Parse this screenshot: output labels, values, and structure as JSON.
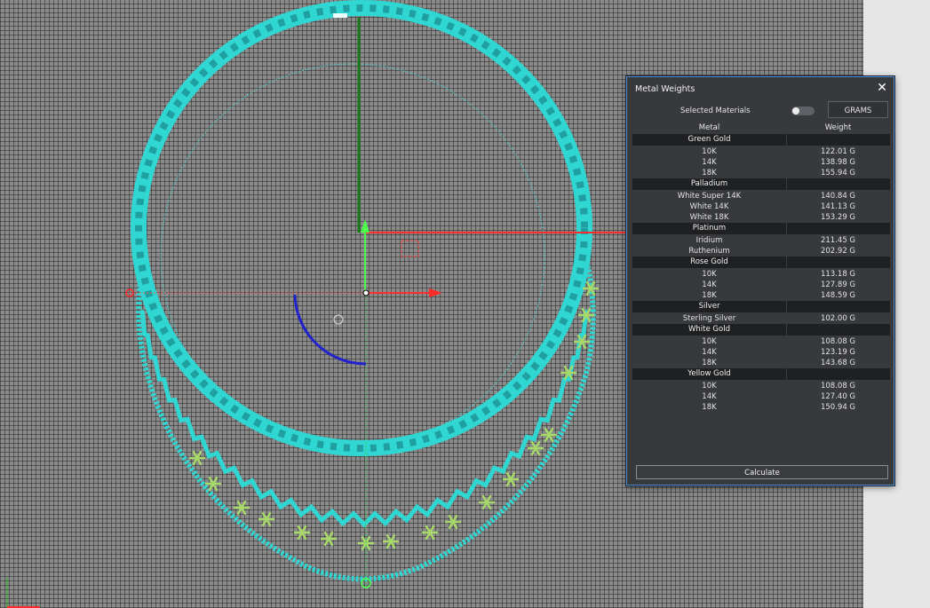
{
  "panel": {
    "title": "Metal Weights",
    "selected_label": "Selected Materials",
    "selected_on": false,
    "units_label": "GRAMS",
    "col_metal": "Metal",
    "col_weight": "Weight",
    "calculate_label": "Calculate",
    "groups": [
      {
        "name": "Green Gold",
        "items": [
          {
            "name": "10K",
            "weight": "122.01 G"
          },
          {
            "name": "14K",
            "weight": "138.98 G"
          },
          {
            "name": "18K",
            "weight": "155.94 G"
          }
        ]
      },
      {
        "name": "Palladium",
        "items": [
          {
            "name": "White Super 14K",
            "weight": "140.84 G"
          },
          {
            "name": "White 14K",
            "weight": "141.13 G"
          },
          {
            "name": "White 18K",
            "weight": "153.29 G"
          }
        ]
      },
      {
        "name": "Platinum",
        "items": [
          {
            "name": "Iridium",
            "weight": "211.45 G"
          },
          {
            "name": "Ruthenium",
            "weight": "202.92 G"
          }
        ]
      },
      {
        "name": "Rose Gold",
        "items": [
          {
            "name": "10K",
            "weight": "113.18 G"
          },
          {
            "name": "14K",
            "weight": "127.89 G"
          },
          {
            "name": "18K",
            "weight": "148.59 G"
          }
        ]
      },
      {
        "name": "Silver",
        "items": [
          {
            "name": "Sterling Silver",
            "weight": "102.00 G"
          }
        ]
      },
      {
        "name": "White Gold",
        "items": [
          {
            "name": "10K",
            "weight": "108.08 G"
          },
          {
            "name": "14K",
            "weight": "123.19 G"
          },
          {
            "name": "18K",
            "weight": "143.68 G"
          }
        ]
      },
      {
        "name": "Yellow Gold",
        "items": [
          {
            "name": "10K",
            "weight": "108.08 G"
          },
          {
            "name": "14K",
            "weight": "127.40 G"
          },
          {
            "name": "18K",
            "weight": "150.94 G"
          }
        ]
      }
    ]
  },
  "colors": {
    "chain": "#2fd6d2",
    "accent": "#4b90d1",
    "axis_x": "#ff2a2a",
    "axis_y": "#1fb81f",
    "arc": "#2222cc"
  }
}
